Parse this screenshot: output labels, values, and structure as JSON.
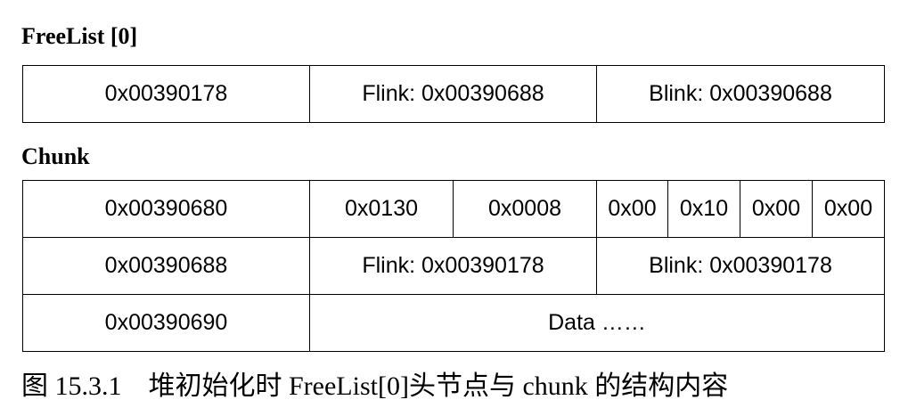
{
  "freelist": {
    "title": "FreeList [0]",
    "address": "0x00390178",
    "flink": "Flink: 0x00390688",
    "blink": "Blink: 0x00390688"
  },
  "chunk": {
    "title": "Chunk",
    "row1": {
      "address": "0x00390680",
      "size": "0x0130",
      "prev_size": "0x0008",
      "bytes": [
        "0x00",
        "0x10",
        "0x00",
        "0x00"
      ]
    },
    "row2": {
      "address": "0x00390688",
      "flink": "Flink: 0x00390178",
      "blink": "Blink: 0x00390178"
    },
    "row3": {
      "address": "0x00390690",
      "data": "Data ……"
    }
  },
  "caption": "图 15.3.1　堆初始化时 FreeList[0]头节点与 chunk 的结构内容"
}
